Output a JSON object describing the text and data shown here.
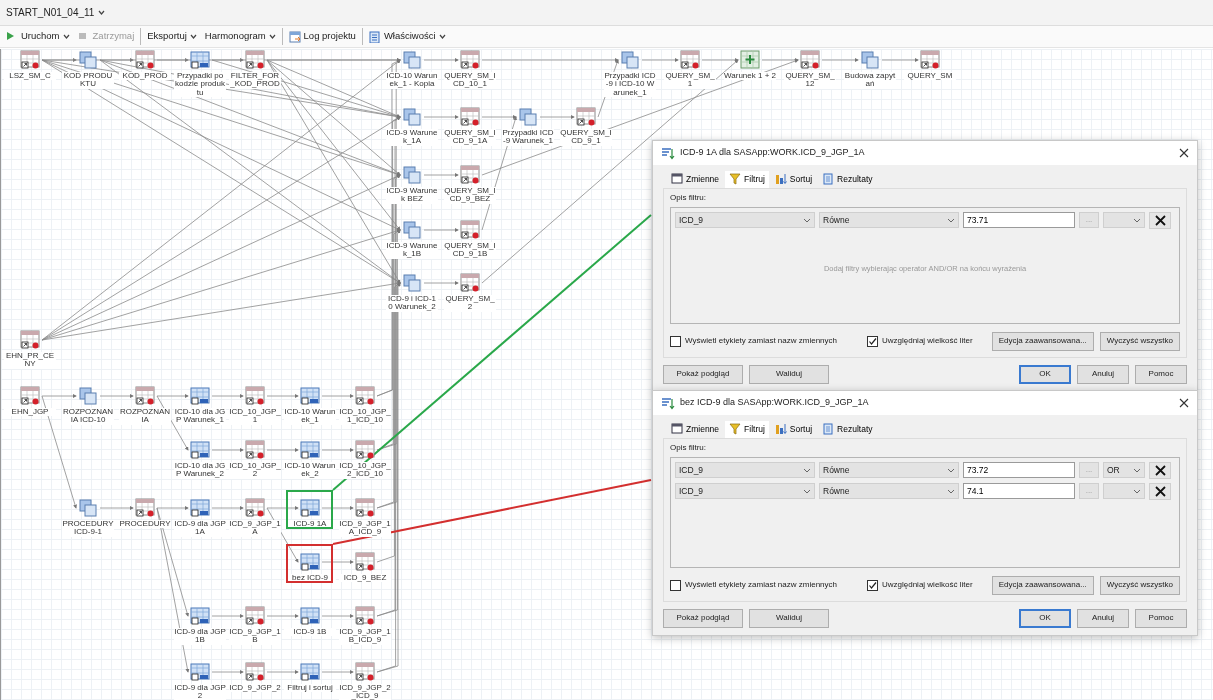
{
  "document_tab": {
    "title": "START_N01_04_11"
  },
  "toolbar": [
    {
      "label": "Uruchom",
      "kind": "run",
      "dropdown": true,
      "disabled": false,
      "separator_before": false
    },
    {
      "label": "Zatrzymaj",
      "kind": "stop",
      "dropdown": false,
      "disabled": true,
      "separator_before": false
    },
    {
      "label": "Eksportuj",
      "kind": "plain",
      "dropdown": true,
      "disabled": false,
      "separator_before": true
    },
    {
      "label": "Harmonogram",
      "kind": "plain",
      "dropdown": true,
      "disabled": false,
      "separator_before": false
    },
    {
      "label": "Log projektu",
      "kind": "log",
      "dropdown": false,
      "disabled": false,
      "separator_before": true
    },
    {
      "label": "Właściwości",
      "kind": "properties",
      "dropdown": true,
      "disabled": false,
      "separator_before": true
    }
  ],
  "flow": {
    "nodes": [
      {
        "label": "LSZ_SM_C",
        "kind": "table"
      },
      {
        "label": "KOD PRODUKTU",
        "kind": "query"
      },
      {
        "label": "KOD_PROD",
        "kind": "table"
      },
      {
        "label": "Przypadki po kodzie produktu",
        "kind": "filter"
      },
      {
        "label": "FILTER_FOR_KOD_PROD",
        "kind": "table"
      },
      {
        "label": "ICD-10 Warunek_1 - Kopia",
        "kind": "query"
      },
      {
        "label": "QUERY_SM_ICD_10_1",
        "kind": "table"
      },
      {
        "label": "Przypadki ICD-9 i ICD-10 Warunek_1",
        "kind": "query"
      },
      {
        "label": "QUERY_SM_1",
        "kind": "table"
      },
      {
        "label": "Warunek 1 + 2",
        "kind": "join"
      },
      {
        "label": "QUERY_SM_12",
        "kind": "table"
      },
      {
        "label": "Budowa zapytań",
        "kind": "query"
      },
      {
        "label": "QUERY_SM",
        "kind": "table"
      },
      {
        "label": "ICD-9 Warunek_1A",
        "kind": "query"
      },
      {
        "label": "QUERY_SM_ICD_9_1A",
        "kind": "table"
      },
      {
        "label": "Przypadki ICD-9 Warunek_1",
        "kind": "query"
      },
      {
        "label": "QUERY_SM_ICD_9_1",
        "kind": "table"
      },
      {
        "label": "ICD-9 Warunek BEZ",
        "kind": "query"
      },
      {
        "label": "QUERY_SM_ICD_9_BEZ",
        "kind": "table"
      },
      {
        "label": "ICD-9 Warunek_1B",
        "kind": "query"
      },
      {
        "label": "QUERY_SM_ICD_9_1B",
        "kind": "table"
      },
      {
        "label": "ICD-9 i ICD-10 Warunek_2",
        "kind": "query"
      },
      {
        "label": "QUERY_SM_2",
        "kind": "table"
      },
      {
        "label": "EHN_PR_CENY",
        "kind": "table"
      },
      {
        "label": "EHN_JGP",
        "kind": "table"
      },
      {
        "label": "ROZPOZNANIA ICD-10",
        "kind": "query"
      },
      {
        "label": "ROZPOZNANIA",
        "kind": "table"
      },
      {
        "label": "ICD-10 dla JGP Warunek_1",
        "kind": "filter"
      },
      {
        "label": "ICD_10_JGP_1",
        "kind": "table"
      },
      {
        "label": "ICD-10 Warunek_1",
        "kind": "filter"
      },
      {
        "label": "ICD_10_JGP_1_ICD_10",
        "kind": "table"
      },
      {
        "label": "ICD-10 dla JGP Warunek_2",
        "kind": "filter"
      },
      {
        "label": "ICD_10_JGP_2",
        "kind": "table"
      },
      {
        "label": "ICD-10 Warunek_2",
        "kind": "filter"
      },
      {
        "label": "ICD_10_JGP_2_ICD_10",
        "kind": "table"
      },
      {
        "label": "PROCEDURY ICD-9-1",
        "kind": "query"
      },
      {
        "label": "PROCEDURY",
        "kind": "table"
      },
      {
        "label": "ICD-9 dla JGP 1A",
        "kind": "filter"
      },
      {
        "label": "ICD_9_JGP_1A",
        "kind": "table"
      },
      {
        "label": "ICD-9 1A",
        "kind": "filter",
        "color": "#2aa84a"
      },
      {
        "label": "ICD_9_JGP_1A_ICD_9",
        "kind": "table"
      },
      {
        "label": "bez ICD-9",
        "kind": "filter",
        "color": "#d32f2f"
      },
      {
        "label": "ICD_9_BEZ",
        "kind": "table"
      },
      {
        "label": "ICD-9 dla JGP 1B",
        "kind": "filter"
      },
      {
        "label": "ICD_9_JGP_1B",
        "kind": "table"
      },
      {
        "label": "ICD-9 1B",
        "kind": "filter"
      },
      {
        "label": "ICD_9_JGP_1B_ICD_9",
        "kind": "table"
      },
      {
        "label": "ICD-9 dla JGP 2",
        "kind": "filter"
      },
      {
        "label": "ICD_9_JGP_2",
        "kind": "table"
      },
      {
        "label": "Filtruj i sortuj",
        "kind": "filter"
      },
      {
        "label": "ICD_9_JGP_2_ICD_9",
        "kind": "table"
      }
    ]
  },
  "dialogs": [
    {
      "title": "ICD-9 1A dla SASApp:WORK.ICD_9_JGP_1A",
      "tabs": [
        {
          "label": "Zmienne",
          "kind": "variables",
          "selected": false
        },
        {
          "label": "Filtruj",
          "kind": "filter",
          "selected": true
        },
        {
          "label": "Sortuj",
          "kind": "sort",
          "selected": false
        },
        {
          "label": "Rezultaty",
          "kind": "results",
          "selected": false
        }
      ],
      "filter_caption": "Opis filtru:",
      "conditions": [
        {
          "column": "ICD_9",
          "operator": "Równe",
          "value": "73.71",
          "browse": "..."
        }
      ],
      "hint": "Dodaj filtry wybierając operator AND/OR na końcu wyrażenia",
      "options": [
        {
          "label": "Wyświetl etykiety zamiast nazw zmiennych",
          "checked": false
        },
        {
          "label": "Uwzględniaj wielkość liter",
          "checked": true
        }
      ],
      "panel_buttons": [
        "Edycja zaawansowana...",
        "Wyczyść wszystko"
      ],
      "footer_left": [
        "Pokaż podgląd",
        "Waliduj"
      ],
      "footer_right": [
        {
          "label": "OK",
          "default": true
        },
        {
          "label": "Anuluj",
          "default": false
        },
        {
          "label": "Pomoc",
          "default": false
        }
      ]
    },
    {
      "title": "bez ICD-9 dla SASApp:WORK.ICD_9_JGP_1A",
      "tabs": [
        {
          "label": "Zmienne",
          "kind": "variables",
          "selected": false
        },
        {
          "label": "Filtruj",
          "kind": "filter",
          "selected": true
        },
        {
          "label": "Sortuj",
          "kind": "sort",
          "selected": false
        },
        {
          "label": "Rezultaty",
          "kind": "results",
          "selected": false
        }
      ],
      "filter_caption": "Opis filtru:",
      "conditions": [
        {
          "column": "ICD_9",
          "operator": "Równe",
          "value": "73.72",
          "browse": "...",
          "connector": "OR"
        },
        {
          "column": "ICD_9",
          "operator": "Równe",
          "value": "74.1",
          "browse": "..."
        }
      ],
      "options": [
        {
          "label": "Wyświetl etykiety zamiast nazw zmiennych",
          "checked": false
        },
        {
          "label": "Uwzględniaj wielkość liter",
          "checked": true
        }
      ],
      "panel_buttons": [
        "Edycja zaawansowana...",
        "Wyczyść wszystko"
      ],
      "footer_left": [
        "Pokaż podgląd",
        "Waliduj"
      ],
      "footer_right": [
        {
          "label": "OK",
          "default": true
        },
        {
          "label": "Anuluj",
          "default": false
        },
        {
          "label": "Pomoc",
          "default": false
        }
      ]
    }
  ]
}
